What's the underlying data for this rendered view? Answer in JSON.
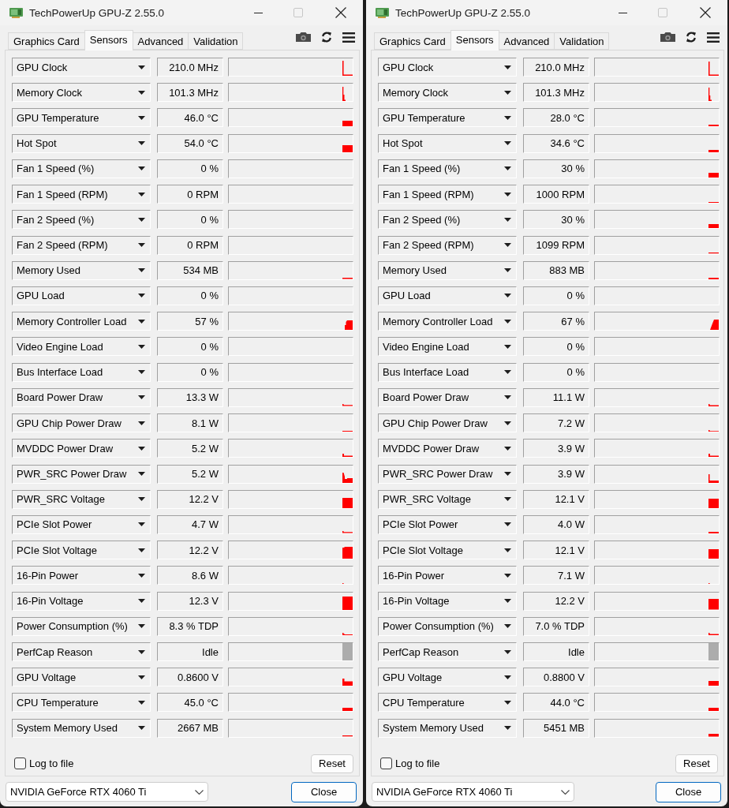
{
  "windows": [
    {
      "title": "TechPowerUp GPU-Z 2.55.0",
      "maximize": {
        "disabled": true
      },
      "tabs": [
        {
          "label": "Graphics Card",
          "selected": false
        },
        {
          "label": "Sensors",
          "selected": true
        },
        {
          "label": "Advanced",
          "selected": false
        },
        {
          "label": "Validation",
          "selected": false
        }
      ],
      "sensors": [
        {
          "name": "GPU Clock",
          "value": "210.0 MHz"
        },
        {
          "name": "Memory Clock",
          "value": "101.3 MHz"
        },
        {
          "name": "GPU Temperature",
          "value": "46.0 °C"
        },
        {
          "name": "Hot Spot",
          "value": "54.0 °C"
        },
        {
          "name": "Fan 1 Speed (%)",
          "value": "0 %"
        },
        {
          "name": "Fan 1 Speed (RPM)",
          "value": "0 RPM"
        },
        {
          "name": "Fan 2 Speed (%)",
          "value": "0 %"
        },
        {
          "name": "Fan 2 Speed (RPM)",
          "value": "0 RPM"
        },
        {
          "name": "Memory Used",
          "value": "534 MB"
        },
        {
          "name": "GPU Load",
          "value": "0 %"
        },
        {
          "name": "Memory Controller Load",
          "value": "57 %"
        },
        {
          "name": "Video Engine Load",
          "value": "0 %"
        },
        {
          "name": "Bus Interface Load",
          "value": "0 %"
        },
        {
          "name": "Board Power Draw",
          "value": "13.3 W"
        },
        {
          "name": "GPU Chip Power Draw",
          "value": "8.1 W"
        },
        {
          "name": "MVDDC Power Draw",
          "value": "5.2 W"
        },
        {
          "name": "PWR_SRC Power Draw",
          "value": "5.2 W"
        },
        {
          "name": "PWR_SRC Voltage",
          "value": "12.2 V"
        },
        {
          "name": "PCIe Slot Power",
          "value": "4.7 W"
        },
        {
          "name": "PCIe Slot Voltage",
          "value": "12.2 V"
        },
        {
          "name": "16-Pin Power",
          "value": "8.6 W"
        },
        {
          "name": "16-Pin Voltage",
          "value": "12.3 V"
        },
        {
          "name": "Power Consumption (%)",
          "value": "8.3 % TDP"
        },
        {
          "name": "PerfCap Reason",
          "value": "Idle"
        },
        {
          "name": "GPU Voltage",
          "value": "0.8600 V"
        },
        {
          "name": "CPU Temperature",
          "value": "45.0 °C"
        },
        {
          "name": "System Memory Used",
          "value": "2667 MB"
        }
      ],
      "log_to_file": {
        "label": "Log to file",
        "checked": false
      },
      "reset_button": "Reset",
      "device": "NVIDIA GeForce RTX 4060 Ti",
      "close_button": "Close"
    },
    {
      "title": "TechPowerUp GPU-Z 2.55.0",
      "maximize": {
        "disabled": true
      },
      "tabs": [
        {
          "label": "Graphics Card",
          "selected": false
        },
        {
          "label": "Sensors",
          "selected": true
        },
        {
          "label": "Advanced",
          "selected": false
        },
        {
          "label": "Validation",
          "selected": false
        }
      ],
      "sensors": [
        {
          "name": "GPU Clock",
          "value": "210.0 MHz"
        },
        {
          "name": "Memory Clock",
          "value": "101.3 MHz"
        },
        {
          "name": "GPU Temperature",
          "value": "28.0 °C"
        },
        {
          "name": "Hot Spot",
          "value": "34.6 °C"
        },
        {
          "name": "Fan 1 Speed (%)",
          "value": "30 %"
        },
        {
          "name": "Fan 1 Speed (RPM)",
          "value": "1000 RPM"
        },
        {
          "name": "Fan 2 Speed (%)",
          "value": "30 %"
        },
        {
          "name": "Fan 2 Speed (RPM)",
          "value": "1099 RPM"
        },
        {
          "name": "Memory Used",
          "value": "883 MB"
        },
        {
          "name": "GPU Load",
          "value": "0 %"
        },
        {
          "name": "Memory Controller Load",
          "value": "67 %"
        },
        {
          "name": "Video Engine Load",
          "value": "0 %"
        },
        {
          "name": "Bus Interface Load",
          "value": "0 %"
        },
        {
          "name": "Board Power Draw",
          "value": "11.1 W"
        },
        {
          "name": "GPU Chip Power Draw",
          "value": "7.2 W"
        },
        {
          "name": "MVDDC Power Draw",
          "value": "3.9 W"
        },
        {
          "name": "PWR_SRC Power Draw",
          "value": "3.9 W"
        },
        {
          "name": "PWR_SRC Voltage",
          "value": "12.1 V"
        },
        {
          "name": "PCIe Slot Power",
          "value": "4.0 W"
        },
        {
          "name": "PCIe Slot Voltage",
          "value": "12.1 V"
        },
        {
          "name": "16-Pin Power",
          "value": "7.1 W"
        },
        {
          "name": "16-Pin Voltage",
          "value": "12.2 V"
        },
        {
          "name": "Power Consumption (%)",
          "value": "7.0 % TDP"
        },
        {
          "name": "PerfCap Reason",
          "value": "Idle"
        },
        {
          "name": "GPU Voltage",
          "value": "0.8800 V"
        },
        {
          "name": "CPU Temperature",
          "value": "44.0 °C"
        },
        {
          "name": "System Memory Used",
          "value": "5451 MB"
        }
      ],
      "log_to_file": {
        "label": "Log to file",
        "checked": false
      },
      "reset_button": "Reset",
      "device": "NVIDIA GeForce RTX 4060 Ti",
      "close_button": "Close"
    }
  ]
}
